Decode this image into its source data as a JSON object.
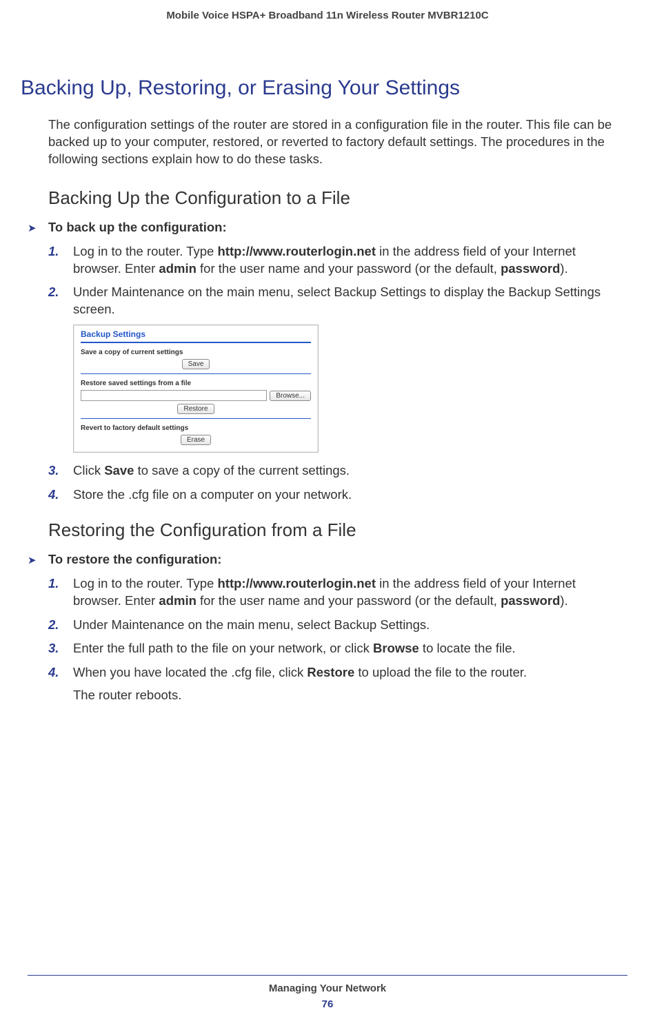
{
  "header": {
    "product_line": "Mobile Voice HSPA+ Broadband 11n Wireless Router MVBR1210C"
  },
  "h1": "Backing Up, Restoring, or Erasing Your Settings",
  "intro": "The configuration settings of the router are stored in a configuration file in the router. This file can be backed up to your computer, restored, or reverted to factory default settings. The procedures in the following sections explain how to do these tasks.",
  "backup": {
    "heading": "Backing Up the Configuration to a File",
    "task": "To back up the configuration:",
    "steps": {
      "s1": {
        "num": "1.",
        "pre": "Log in to the router. Type ",
        "url": "http://www.routerlogin.net",
        "mid1": " in the address field of your Internet browser. Enter ",
        "admin": "admin",
        "mid2": " for the user name and your password (or the default, ",
        "password": "password",
        "end": ")."
      },
      "s2": {
        "num": "2.",
        "text": "Under Maintenance on the main menu, select Backup Settings to display the Backup Settings screen."
      },
      "s3": {
        "num": "3.",
        "pre": "Click ",
        "b": "Save",
        "post": " to save a copy of the current settings."
      },
      "s4": {
        "num": "4.",
        "text": "Store the .cfg file on a computer on your network."
      }
    }
  },
  "restore": {
    "heading": "Restoring the Configuration from a File",
    "task": "To restore the configuration:",
    "steps": {
      "s1": {
        "num": "1.",
        "pre": "Log in to the router. Type ",
        "url": "http://www.routerlogin.net",
        "mid1": " in the address field of your Internet browser. Enter ",
        "admin": "admin",
        "mid2": " for the user name and your password (or the default, ",
        "password": "password",
        "end": ")."
      },
      "s2": {
        "num": "2.",
        "text": "Under Maintenance on the main menu, select Backup Settings."
      },
      "s3": {
        "num": "3.",
        "pre": "Enter the full path to the file on your network, or click ",
        "b": "Browse",
        "post": " to locate the file."
      },
      "s4": {
        "num": "4.",
        "pre": "When you have located the .cfg file, click ",
        "b": "Restore",
        "post": " to upload the file to the router."
      }
    },
    "after": "The router reboots."
  },
  "shot": {
    "title": "Backup Settings",
    "save_group": "Save a copy of current settings",
    "save_btn": "Save",
    "restore_group": "Restore saved settings from a file",
    "browse_btn": "Browse...",
    "restore_btn": "Restore",
    "revert_group": "Revert to factory default settings",
    "erase_btn": "Erase"
  },
  "footer": {
    "chapter": "Managing Your Network",
    "page": "76"
  }
}
